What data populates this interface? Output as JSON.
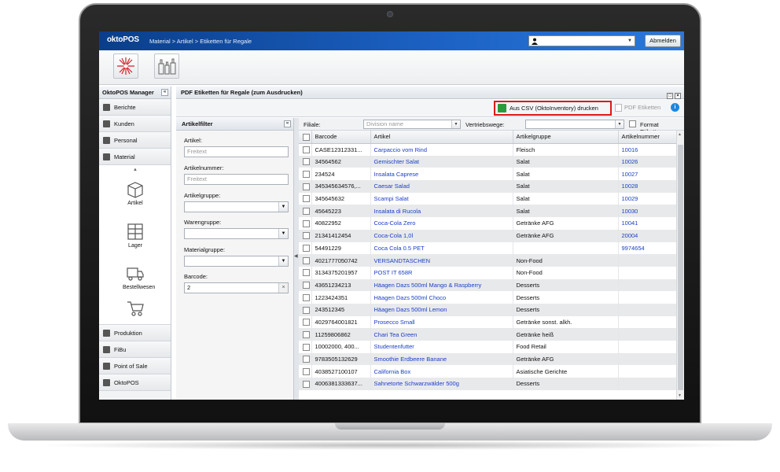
{
  "app": {
    "logo": "oktoPOS",
    "breadcrumb": "Material > Artikel > Etiketten für Regale",
    "logout_label": "Abmelden"
  },
  "sidebar": {
    "title": "OktoPOS Manager",
    "top_items": [
      {
        "label": "Berichte"
      },
      {
        "label": "Kunden"
      },
      {
        "label": "Personal"
      },
      {
        "label": "Material"
      }
    ],
    "material_items": [
      {
        "label": "Artikel"
      },
      {
        "label": "Lager"
      },
      {
        "label": "Bestellwesen"
      },
      {
        "label": ""
      }
    ],
    "bottom_items": [
      {
        "label": "Produktion"
      },
      {
        "label": "FiBu"
      },
      {
        "label": "Point of Sale"
      },
      {
        "label": "OktoPOS"
      }
    ]
  },
  "main": {
    "title": "PDF Etiketten für Regale (zum Ausdrucken)",
    "csv_button": "Aus CSV (OktoInventory) drucken",
    "pdf_button": "PDF Etiketten"
  },
  "filter": {
    "title": "Artikelfilter",
    "artikel_label": "Artikel:",
    "artikel_placeholder": "Freitext",
    "artikelnummer_label": "Artikelnummer:",
    "artikelnummer_placeholder": "Freitext",
    "artikelgruppe_label": "Artikelgruppe:",
    "warengruppe_label": "Warengruppe:",
    "materialgruppe_label": "Materialgruppe:",
    "barcode_label": "Barcode:",
    "barcode_value": "2"
  },
  "grid": {
    "filiale_label": "Filiale:",
    "division_placeholder": "Division name",
    "vertriebswege_label": "Vertriebswege:",
    "format_label": "Format Etiketten:",
    "columns": [
      "Barcode",
      "Artikel",
      "Artikelgruppe",
      "Artikelnummer"
    ],
    "rows": [
      [
        "CASE12312331...",
        "Carpaccio vom Rind",
        "Fleisch",
        "10016"
      ],
      [
        "34564562",
        "Gemischter Salat",
        "Salat",
        "10026"
      ],
      [
        "234524",
        "Insalata Caprese",
        "Salat",
        "10027"
      ],
      [
        "345345634576,...",
        "Caesar Salad",
        "Salat",
        "10028"
      ],
      [
        "345645632",
        "Scampi Salat",
        "Salat",
        "10029"
      ],
      [
        "45645223",
        "Insalata di Rucola",
        "Salat",
        "10030"
      ],
      [
        "40822952",
        "Coca-Cola Zero",
        "Getränke AFG",
        "10041"
      ],
      [
        "21341412454",
        "Coca-Cola 1,0l",
        "Getränke AFG",
        "20004"
      ],
      [
        "54491229",
        "Coca Cola 0.5 PET",
        "",
        "9974654"
      ],
      [
        "4021777050742",
        "VERSANDTASCHEN",
        "Non-Food",
        ""
      ],
      [
        "3134375201957",
        "POST IT 658R",
        "Non-Food",
        ""
      ],
      [
        "43651234213",
        "Häagen Dazs 500ml Mango & Raspberry",
        "Desserts",
        ""
      ],
      [
        "1223424351",
        "Häagen Dazs 500ml Choco",
        "Desserts",
        ""
      ],
      [
        "243512345",
        "Häagen Dazs 500ml Lemon",
        "Desserts",
        ""
      ],
      [
        "4029764001821",
        "Prosecco Small",
        "Getränke sonst. alkh.",
        ""
      ],
      [
        "11259806862",
        "Chari Tea Green",
        "Getränke heiß",
        ""
      ],
      [
        "10002000, 400...",
        "Studentenfutter",
        "Food Retail",
        ""
      ],
      [
        "9783505132629",
        "Smoothie Erdbeere Banane",
        "Getränke AFG",
        ""
      ],
      [
        "4038527100107",
        "California Box",
        "Asiatische Gerichte",
        ""
      ],
      [
        "4006381333637...",
        "Sahnetorte Schwarzwälder 500g",
        "Desserts",
        ""
      ]
    ]
  }
}
